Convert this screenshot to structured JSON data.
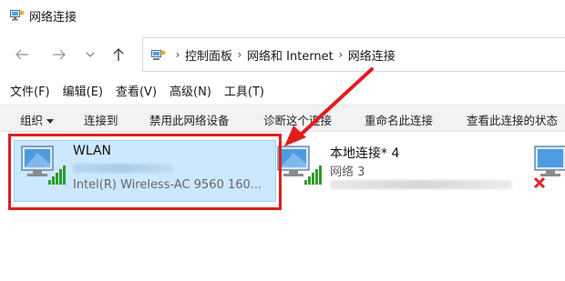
{
  "window": {
    "title": "网络连接"
  },
  "nav": {
    "back_icon": "arrow-left-icon",
    "forward_icon": "arrow-right-icon",
    "recent_icon": "chevron-down-icon",
    "up_icon": "arrow-up-icon"
  },
  "breadcrumb": [
    "控制面板",
    "网络和 Internet",
    "网络连接"
  ],
  "menu": [
    "文件(F)",
    "编辑(E)",
    "查看(V)",
    "高级(N)",
    "工具(T)"
  ],
  "commands": {
    "organize": "组织",
    "connect_to": "连接到",
    "disable": "禁用此网络设备",
    "diagnose": "诊断这个连接",
    "rename": "重命名此连接",
    "view_status": "查看此连接的状态"
  },
  "connections": [
    {
      "name": "WLAN",
      "device": "Intel(R) Wireless-AC 9560 160...",
      "icon": "wifi-signal-icon",
      "selected": true
    },
    {
      "name": "本地连接* 4",
      "status": "网络 3",
      "icon": "wifi-signal-icon",
      "selected": false
    },
    {
      "icon": "network-disconnected-icon",
      "selected": false
    }
  ],
  "colors": {
    "selection_bg": "#cce8ff",
    "selection_border": "#99d1ff",
    "annotation_red": "#e01e1e",
    "signal_green": "#2e9a2e"
  }
}
